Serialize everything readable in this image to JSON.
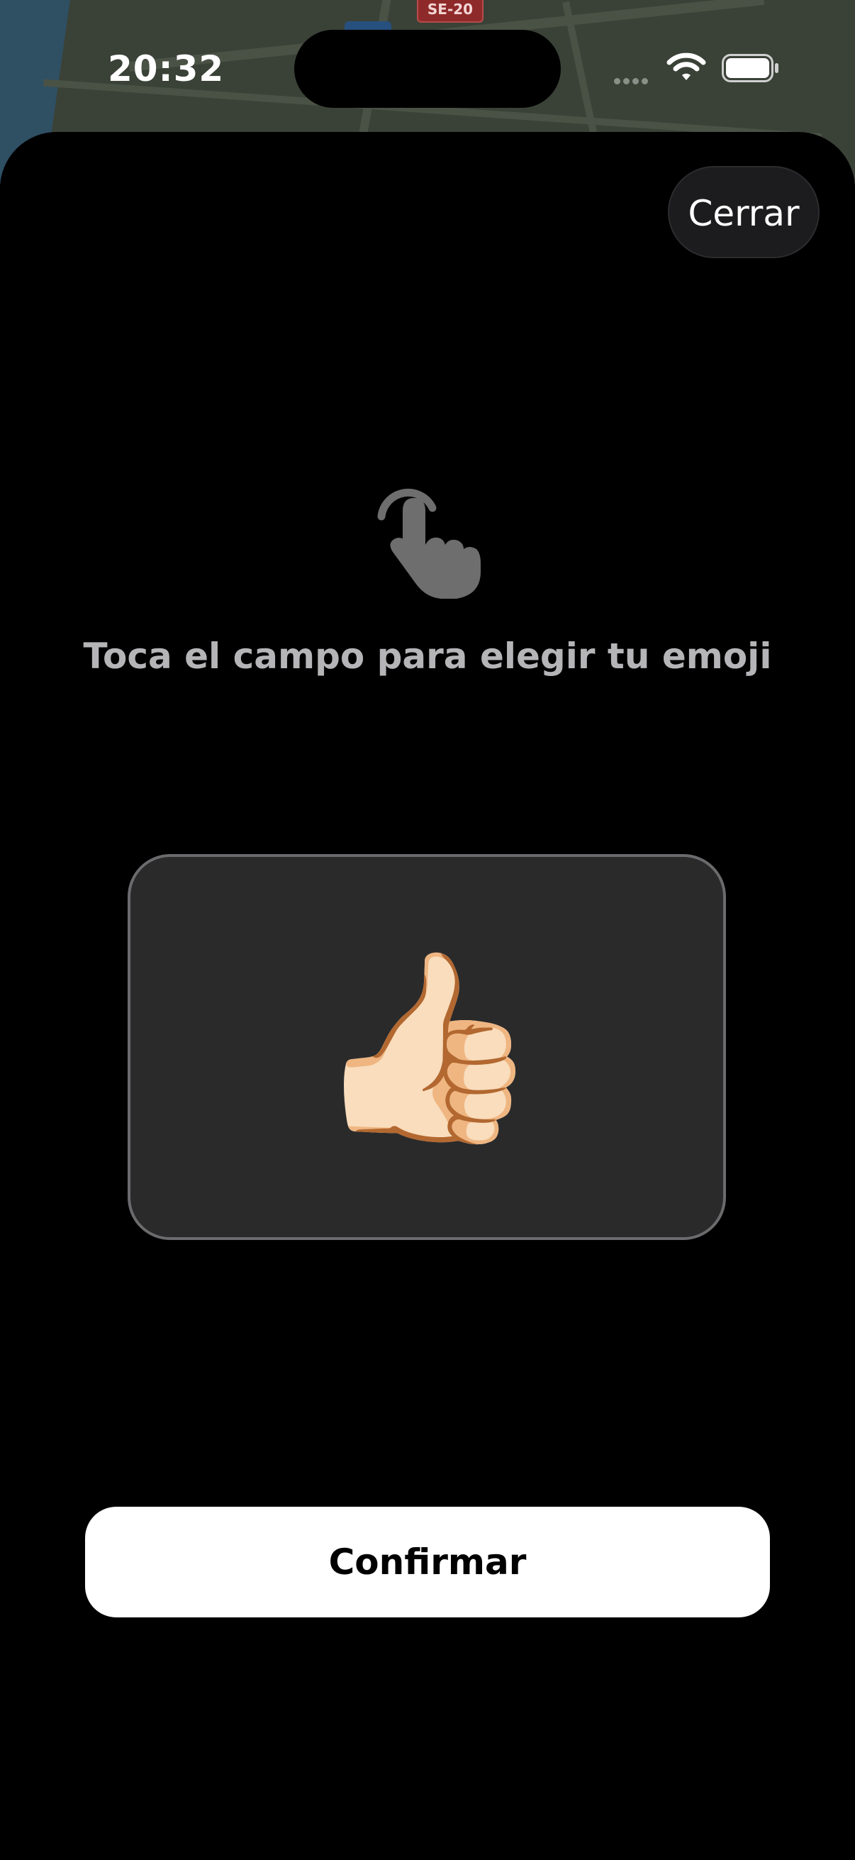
{
  "status_bar": {
    "time": "20:32",
    "icons": [
      "signal-dots-icon",
      "wifi-icon",
      "battery-icon"
    ]
  },
  "map": {
    "road_sign": "SE-20"
  },
  "sheet": {
    "close_label": "Cerrar",
    "hint_icon": "tap-hand-icon",
    "prompt": "Toca el campo para elegir tu emoji",
    "emoji_field": {
      "value": "👍🏻"
    },
    "confirm_label": "Confirmar"
  },
  "colors": {
    "background": "#000000",
    "field_background": "#2a2a2b",
    "field_border": "#6b6b6e",
    "prompt_text": "#b5b5b8",
    "button_background": "#ffffff"
  }
}
